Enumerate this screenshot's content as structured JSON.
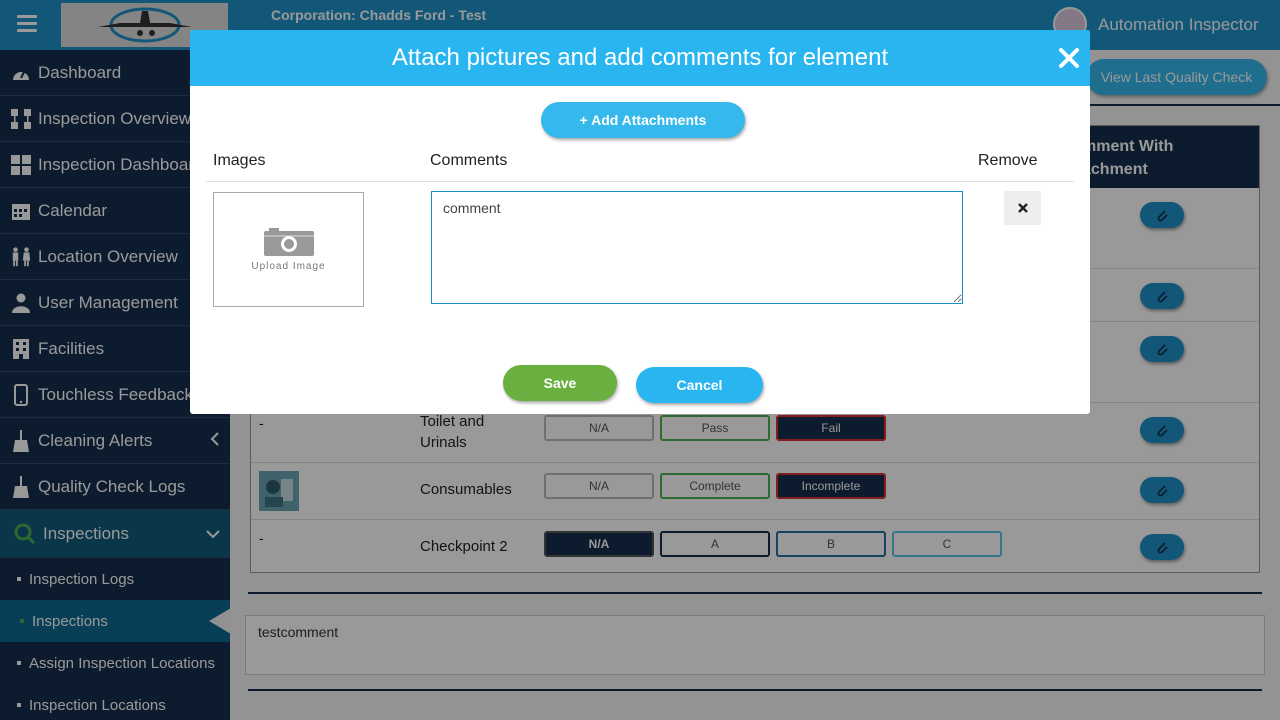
{
  "topbar": {
    "corporation": "Corporation: Chadds Ford - Test",
    "user_name": "Automation Inspector"
  },
  "sidebar": {
    "items": [
      {
        "label": "Dashboard",
        "icon": "dashboard-gauge-icon"
      },
      {
        "label": "Inspection Overview",
        "icon": "sitemap-icon"
      },
      {
        "label": "Inspection Dashboard",
        "icon": "grid-icon"
      },
      {
        "label": "Calendar",
        "icon": "calendar-icon"
      },
      {
        "label": "Location Overview",
        "icon": "people-icon"
      },
      {
        "label": "User Management",
        "icon": "user-icon"
      },
      {
        "label": "Facilities",
        "icon": "building-icon"
      },
      {
        "label": "Touchless Feedback",
        "icon": "mobile-icon"
      },
      {
        "label": "Cleaning Alerts",
        "icon": "broom-icon"
      },
      {
        "label": "Quality Check Logs",
        "icon": "broom-icon"
      },
      {
        "label": "Inspections",
        "icon": "search-icon"
      }
    ],
    "sub_items": [
      {
        "label": "Inspection Logs"
      },
      {
        "label": "Inspections"
      },
      {
        "label": "Assign Inspection Locations"
      },
      {
        "label": "Inspection Locations"
      }
    ]
  },
  "main": {
    "view_last_quality_check": "View Last Quality Check",
    "column_header": "mment With\nachment",
    "rows": [
      {
        "image": "-",
        "name": "Toilet and\nUrinals",
        "options": [
          "N/A",
          "Pass",
          "Fail"
        ],
        "selected": "Fail"
      },
      {
        "image": "thumbnail",
        "name": "Consumables",
        "options": [
          "N/A",
          "Complete",
          "Incomplete"
        ],
        "selected": "Incomplete"
      },
      {
        "image": "-",
        "name": "Checkpoint 2",
        "options": [
          "N/A",
          "A",
          "B",
          "C"
        ],
        "selected": "N/A"
      }
    ],
    "bottom_comment": "testcomment"
  },
  "modal": {
    "title": "Attach pictures and add comments for element",
    "add_attachments": "+ Add Attachments",
    "headers": {
      "images": "Images",
      "comments": "Comments",
      "remove": "Remove"
    },
    "upload_label": "Upload Image",
    "comment_value": "comment",
    "save": "Save",
    "cancel": "Cancel"
  },
  "colors": {
    "topbar": "#1e90c8",
    "sidebar": "#15304d",
    "modal_header": "#29b6f0",
    "save": "#6ab040",
    "fail": "#15304d"
  }
}
